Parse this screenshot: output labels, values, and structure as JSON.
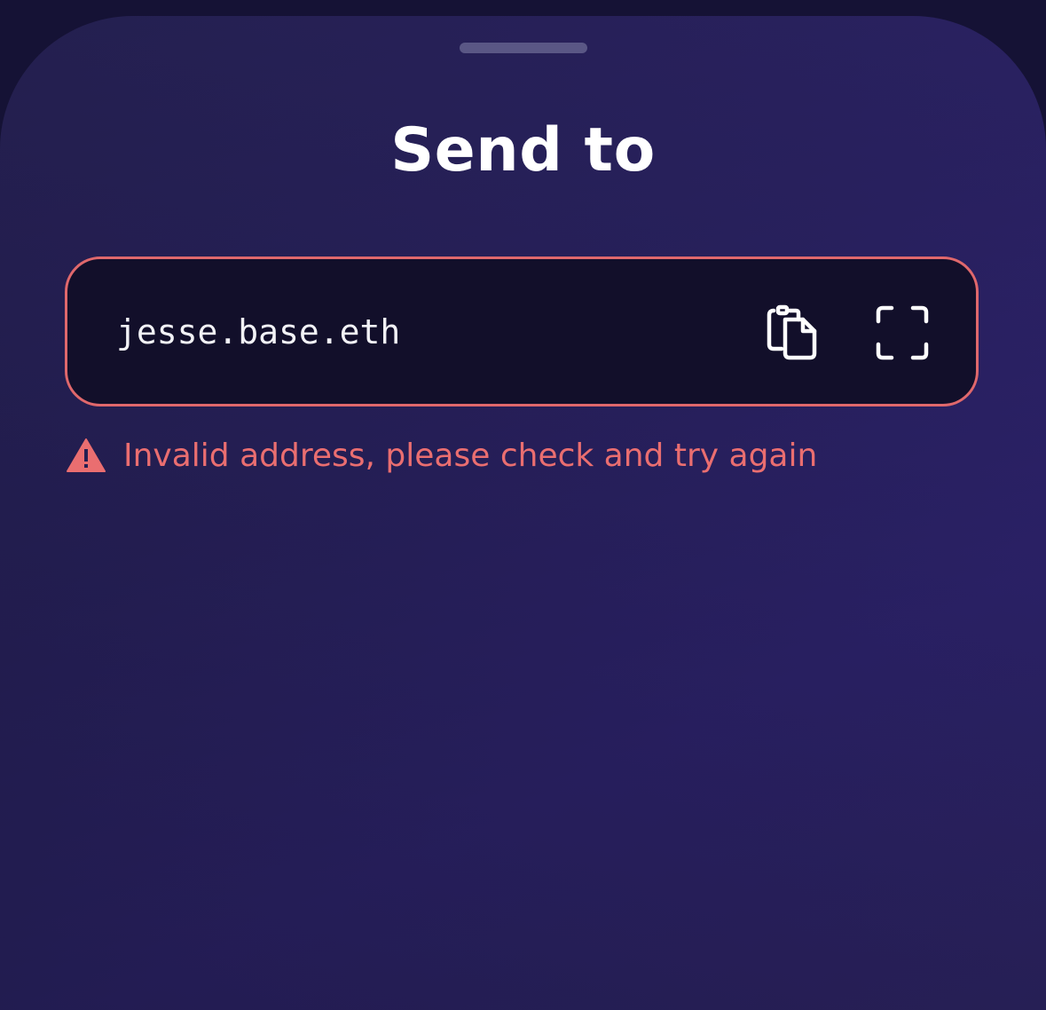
{
  "sheet": {
    "title": "Send to",
    "grabber_icon": "drag-handle"
  },
  "recipient_field": {
    "value": "jesse.base.eth",
    "paste_icon": "clipboard-icon",
    "scan_icon": "scan-qr-icon",
    "border_color": "#e0686c"
  },
  "error": {
    "icon": "warning-triangle-icon",
    "message": "Invalid address, please check and try again",
    "color": "#ea6e70"
  }
}
